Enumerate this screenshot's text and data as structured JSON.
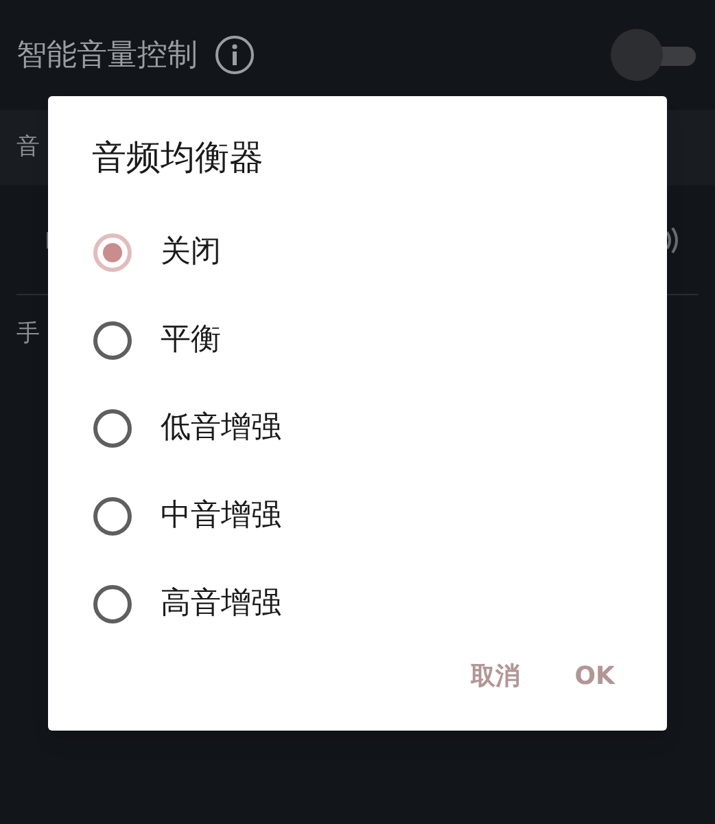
{
  "header": {
    "title": "智能音量控制",
    "switch_on": false
  },
  "section": {
    "label": "音"
  },
  "next_item": {
    "label": "手"
  },
  "dialog": {
    "title": "音频均衡器",
    "options": [
      {
        "label": "关闭",
        "selected": true
      },
      {
        "label": "平衡",
        "selected": false
      },
      {
        "label": "低音增强",
        "selected": false
      },
      {
        "label": "中音增强",
        "selected": false
      },
      {
        "label": "高音增强",
        "selected": false
      }
    ],
    "buttons": [
      "取消",
      "OK"
    ]
  }
}
